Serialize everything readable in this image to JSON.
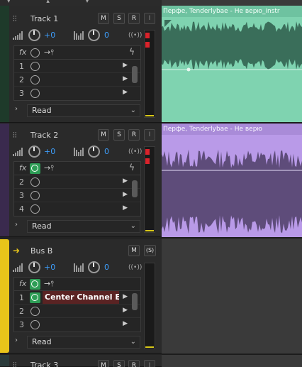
{
  "tracks": [
    {
      "name": "Track 1",
      "volume": "+0",
      "pan": "0",
      "stripe": "#1e3a2a",
      "fx_slots": [
        "1",
        "2",
        "3"
      ],
      "mode": "Read"
    },
    {
      "name": "Track 2",
      "volume": "+0",
      "pan": "0",
      "stripe": "#3a2a4e",
      "fx_slots": [
        "2",
        "3",
        "4"
      ],
      "mode": "Read"
    },
    {
      "name": "Bus B",
      "volume": "+0",
      "pan": "0",
      "stripe": "#e8c51a",
      "fx_slots": [
        "1",
        "2",
        "3"
      ],
      "effect": "Center Channel Extra",
      "mode": "Read"
    },
    {
      "name": "Track 3"
    }
  ],
  "buttons": {
    "mute": "M",
    "solo": "S",
    "rec": "R",
    "input": "I",
    "bus_solo": "(S)"
  },
  "labels": {
    "fx": "fx"
  },
  "clips": [
    {
      "title": "Перфе, Tenderlybae - Не верю_instr",
      "color": "#7fd3b0",
      "wave": "#3a6e5a"
    },
    {
      "title": "Перфе, Tenderlybae - Не верю",
      "color": "#b99ae8",
      "wave": "#5e4c7a"
    }
  ],
  "colors": {
    "accent_blue": "#3ea0ff",
    "power_green": "#2e9e56",
    "bus_yellow": "#e8c51a",
    "peak_red": "#d9232b"
  }
}
